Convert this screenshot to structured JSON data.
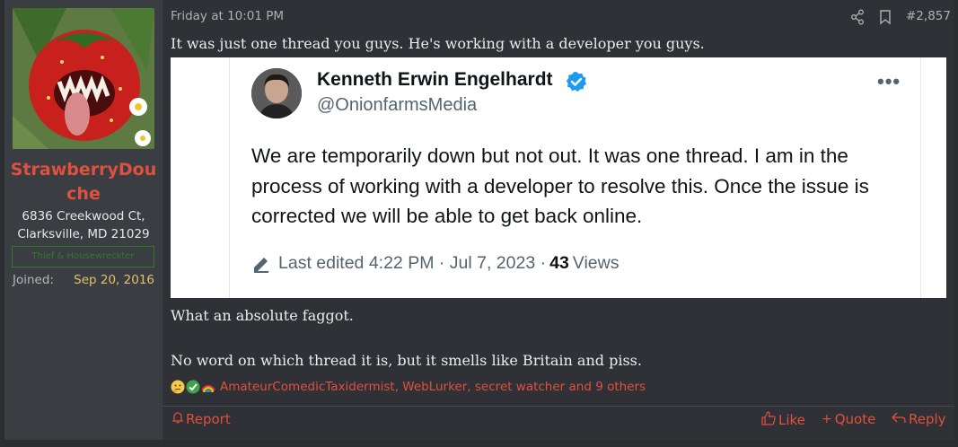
{
  "user": {
    "name": "StrawberryDouche",
    "name_line1": "StrawberryDou",
    "name_line2": "che",
    "location_line1": "6836 Creekwood Ct,",
    "location_line2": "Clarksville, MD 21029",
    "badge": "Thief & Housewreckter",
    "joined_label": "Joined:",
    "joined_value": "Sep 20, 2016"
  },
  "post": {
    "date": "Friday at 10:01 PM",
    "number": "#2,857",
    "line1": "It was just one thread you guys. He's working with a developer you guys.",
    "line2": "What an absolute faggot.",
    "line3": "No word on which thread it is, but it smells like Britain and piss."
  },
  "tweet": {
    "name": "Kenneth Erwin Engelhardt",
    "handle": "@OnionfarmsMedia",
    "more": "•••",
    "body": "We are temporarily down but not out. It was one thread. I am in the process of working with a developer to resolve this. Once the issue is corrected we will be able to get back online.",
    "edited": "Last edited 4:22 PM · Jul 7, 2023 ·",
    "views_count": "43",
    "views_label": "Views"
  },
  "reactions": {
    "icons": [
      "thinking-face-icon",
      "check-icon",
      "rainbow-icon"
    ],
    "text": "AmateurComedicTaxidermist, WebLurker, secret watcher and 9 others"
  },
  "actions": {
    "report": "Report",
    "like": "Like",
    "quote": "Quote",
    "reply": "Reply"
  },
  "colors": {
    "accent": "#e0503d",
    "joined_date": "#e4c06b",
    "badge_green": "#2f7a2f",
    "verified_blue": "#1d9bf0"
  }
}
